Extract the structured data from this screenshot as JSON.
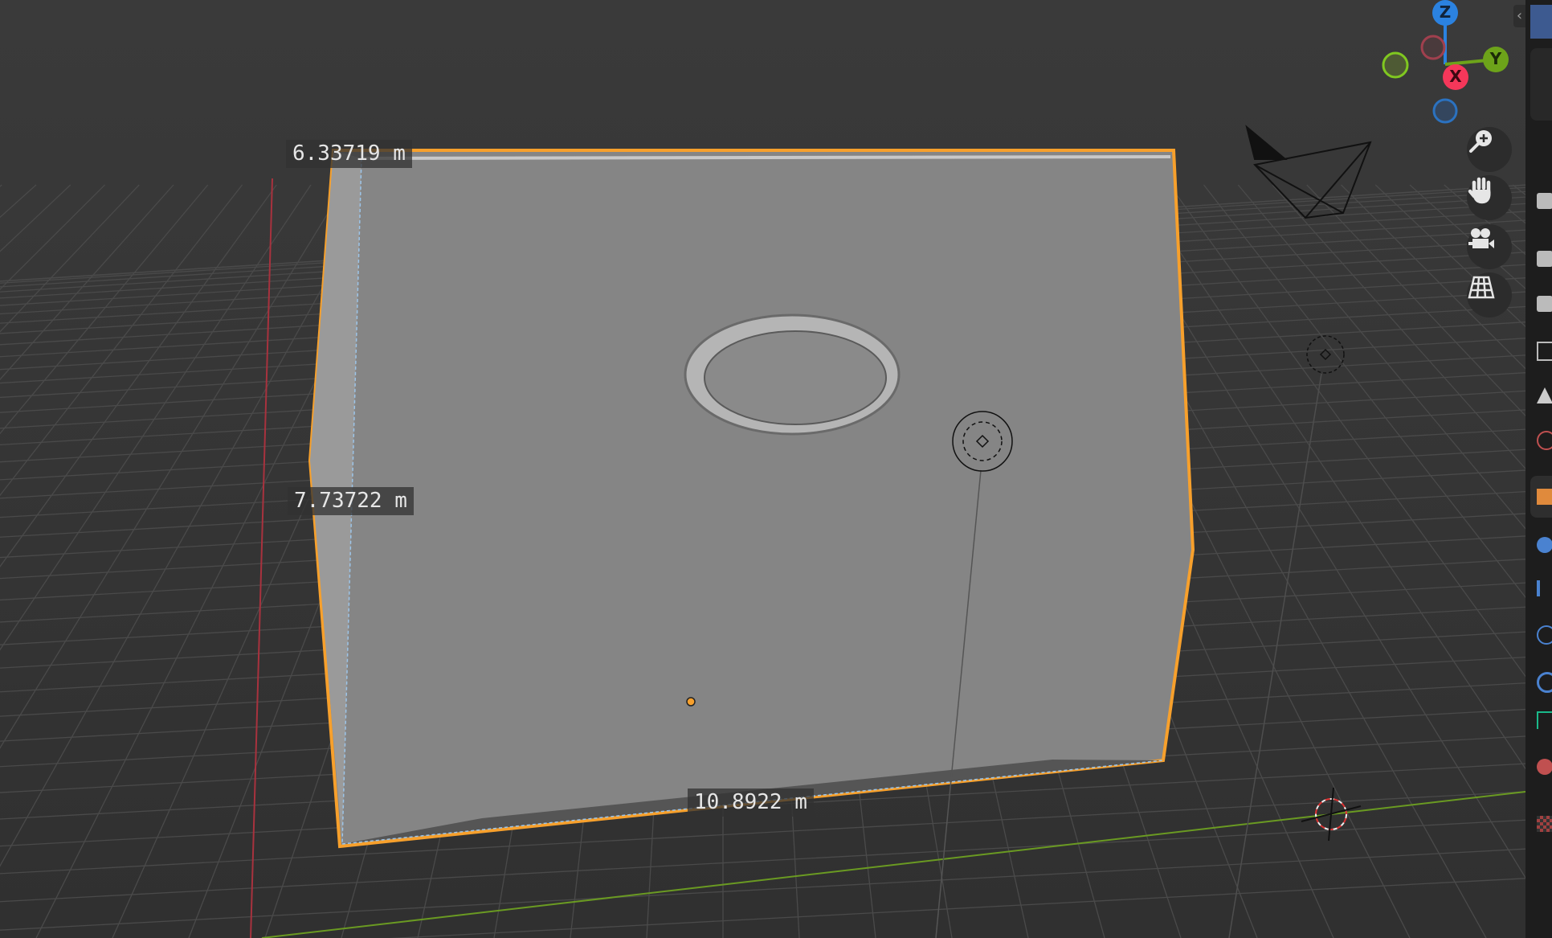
{
  "viewport": {
    "measurements": [
      "6.33719 m",
      "7.73722 m",
      "10.8922 m"
    ],
    "gizmo": {
      "z_label": "Z",
      "y_label": "Y",
      "x_label": "X",
      "colors": {
        "x": "#f5375a",
        "y": "#6da31a",
        "z": "#2b82e0"
      }
    },
    "nav_buttons": [
      "zoom-icon",
      "hand-pan-icon",
      "camera-view-icon",
      "perspective-grid-icon"
    ],
    "selection_color": "#f7a02c"
  },
  "sidebar": {
    "collapse_glyph": "‹",
    "icons": [
      "tool-icon",
      "render-icon",
      "output-icon",
      "view-layer-icon",
      "scene-icon",
      "world-icon",
      "object-icon",
      "modifier-icon",
      "particles-icon",
      "physics-icon",
      "constraints-icon",
      "data-icon",
      "material-icon",
      "texture-icon"
    ]
  }
}
